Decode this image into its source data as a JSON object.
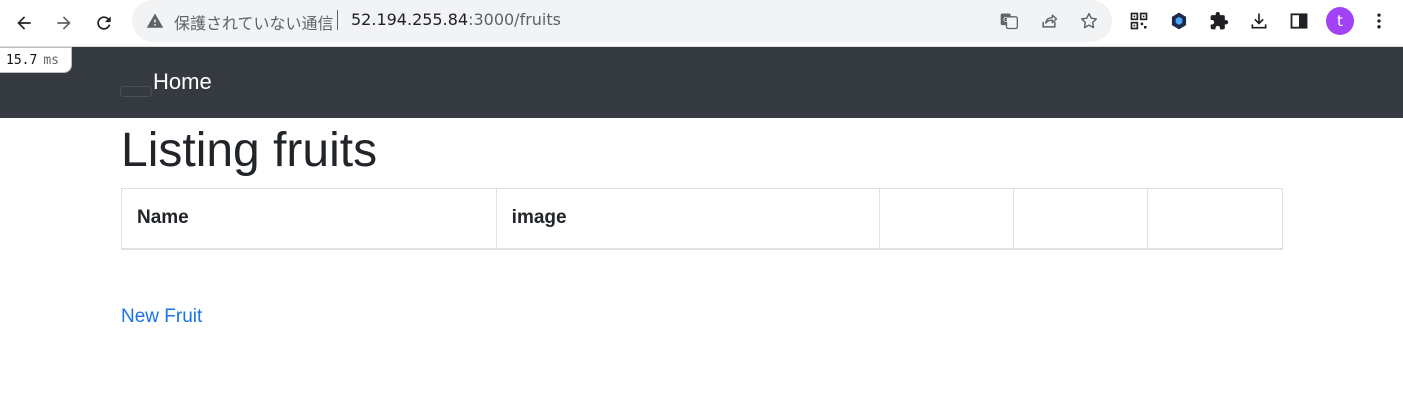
{
  "browser": {
    "security_label": "保護されていない通信",
    "url_host": "52.194.255.84",
    "url_path": ":3000/fruits",
    "profile_initial": "t"
  },
  "timing": {
    "value": "15.7",
    "unit": "ms"
  },
  "navbar": {
    "brand": "Home"
  },
  "page": {
    "title": "Listing fruits",
    "table": {
      "headers": [
        "Name",
        "image",
        "",
        "",
        ""
      ]
    },
    "new_link": "New Fruit"
  },
  "colors": {
    "navbar_bg": "#343a40",
    "link": "#1a73e8",
    "avatar_bg": "#a142f4"
  }
}
